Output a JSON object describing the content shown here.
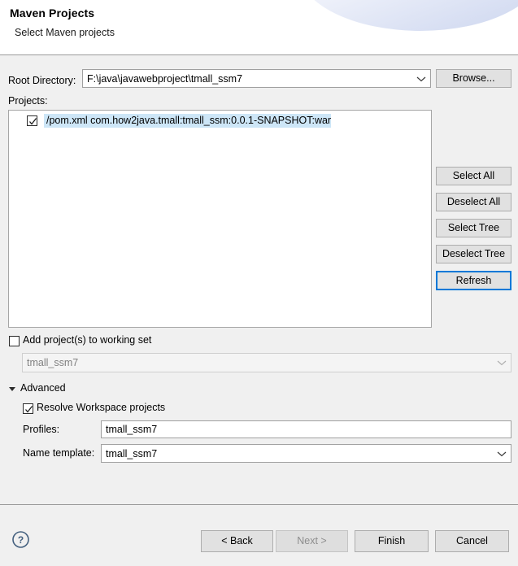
{
  "header": {
    "title": "Maven Projects",
    "subtitle": "Select Maven projects"
  },
  "form": {
    "root_directory_label": "Root Directory:",
    "root_directory_value": "F:\\java\\javawebproject\\tmall_ssm7",
    "browse_label": "Browse...",
    "projects_label": "Projects:"
  },
  "projects": [
    {
      "checked": true,
      "label": "/pom.xml  com.how2java.tmall:tmall_ssm:0.0.1-SNAPSHOT:war"
    }
  ],
  "side_buttons": {
    "select_all": "Select All",
    "deselect_all": "Deselect All",
    "select_tree": "Select Tree",
    "deselect_tree": "Deselect Tree",
    "refresh": "Refresh"
  },
  "working_set": {
    "checkbox_label": "Add project(s) to working set",
    "checked": false,
    "combo_value": "tmall_ssm7",
    "enabled": false
  },
  "advanced": {
    "section_label": "Advanced",
    "expanded": true,
    "resolve_workspace_label": "Resolve Workspace projects",
    "resolve_workspace_checked": true,
    "profiles_label": "Profiles:",
    "profiles_value": "tmall_ssm7",
    "name_template_label": "Name template:",
    "name_template_value": "tmall_ssm7"
  },
  "footer": {
    "help_icon": "help-circle-icon",
    "back": "< Back",
    "next": "Next >",
    "next_disabled": true,
    "finish": "Finish",
    "cancel": "Cancel"
  },
  "colors": {
    "focus_border": "#0078d7",
    "selection_highlight": "#cde6f7",
    "dialog_background": "#f0f0f0",
    "help_icon": "#44607f"
  }
}
